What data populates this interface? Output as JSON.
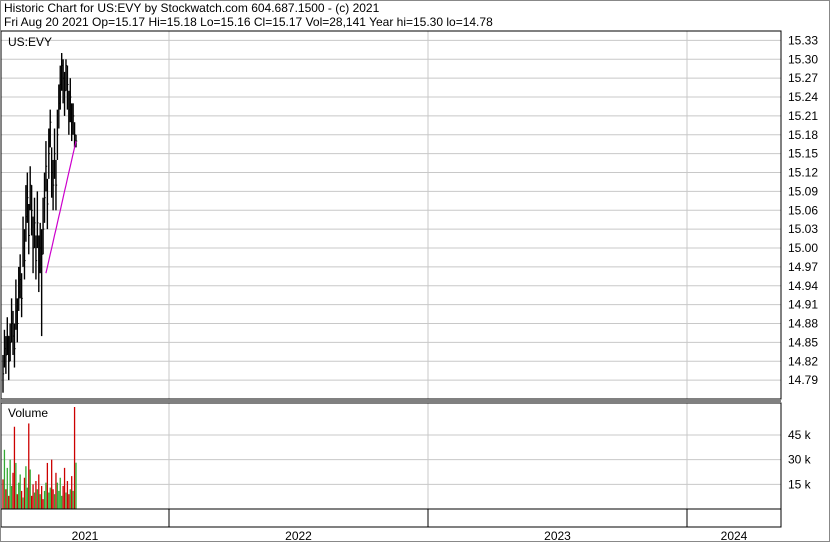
{
  "header": {
    "line1": "Historic Chart for US:EVY by Stockwatch.com 604.687.1500 - (c) 2021",
    "line2": "Fri Aug 20 2021  Op=15.17  Hi=15.18  Lo=15.16  Cl=15.17  Vol=28,141  Year hi=15.30  lo=14.78"
  },
  "colors": {
    "price": "#000000",
    "moving_average": "#cc00cc",
    "volume_up": "#33aa33",
    "volume_down": "#cc0000",
    "grid": "#c8c8c8",
    "frame": "#000000"
  },
  "chart_data": [
    {
      "type": "line",
      "series_label": "US:EVY",
      "y_ticks": [
        "15.33",
        "15.30",
        "15.27",
        "15.24",
        "15.21",
        "15.18",
        "15.15",
        "15.12",
        "15.09",
        "15.06",
        "15.03",
        "15.00",
        "14.97",
        "14.94",
        "14.91",
        "14.88",
        "14.85",
        "14.82",
        "14.79"
      ],
      "ylim": [
        14.76,
        15.345
      ],
      "x_ticks": [
        "2021",
        "2022",
        "2023",
        "2024"
      ],
      "year_hi": 15.3,
      "year_lo": 14.78,
      "grid": true,
      "series": [
        {
          "values": [
            14.8,
            14.84,
            14.83,
            14.86,
            14.82,
            14.85,
            14.88,
            14.86,
            14.84,
            14.9,
            14.88,
            14.93,
            14.95,
            14.92,
            15.0,
            14.98,
            15.05,
            15.08,
            15.02,
            15.1,
            15.06,
            15.0,
            15.04,
            14.98,
            15.04,
            14.97,
            15.0,
            14.99,
            15.03,
            15.08,
            15.13,
            15.07,
            15.15,
            15.2,
            15.12,
            15.1,
            15.15,
            15.1,
            15.18,
            15.23,
            15.26,
            15.29,
            15.27,
            15.25,
            15.29,
            15.26,
            15.22,
            15.24,
            15.2,
            15.21,
            15.18,
            15.17
          ],
          "highs": [
            14.83,
            14.87,
            14.86,
            14.89,
            14.86,
            14.88,
            14.92,
            14.9,
            14.88,
            14.95,
            14.92,
            14.97,
            14.99,
            14.96,
            15.05,
            15.03,
            15.1,
            15.12,
            15.07,
            15.13,
            15.1,
            15.05,
            15.08,
            15.02,
            15.09,
            15.02,
            15.04,
            15.03,
            15.08,
            15.12,
            15.17,
            15.11,
            15.19,
            15.22,
            15.16,
            15.14,
            15.19,
            15.14,
            15.22,
            15.26,
            15.29,
            15.31,
            15.3,
            15.28,
            15.3,
            15.29,
            15.25,
            15.27,
            15.23,
            15.23,
            15.2,
            15.18
          ],
          "lows": [
            14.77,
            14.81,
            14.8,
            14.83,
            14.79,
            14.82,
            14.85,
            14.83,
            14.81,
            14.87,
            14.85,
            14.9,
            14.92,
            14.89,
            14.97,
            14.95,
            15.01,
            15.04,
            14.99,
            15.06,
            15.02,
            14.96,
            15.0,
            14.95,
            15.0,
            14.93,
            14.96,
            14.86,
            14.99,
            15.04,
            15.09,
            15.03,
            15.11,
            15.16,
            15.08,
            15.06,
            15.11,
            15.06,
            15.14,
            15.19,
            15.22,
            15.25,
            15.23,
            15.21,
            15.25,
            15.22,
            15.18,
            15.2,
            15.17,
            15.18,
            15.16,
            15.16
          ]
        },
        {
          "type": "moving_average",
          "start_index": 30,
          "values": [
            14.96,
            14.97,
            14.98,
            14.99,
            15.0,
            15.01,
            15.02,
            15.03,
            15.04,
            15.05,
            15.06,
            15.07,
            15.08,
            15.09,
            15.1,
            15.11,
            15.12,
            15.13,
            15.14,
            15.15,
            15.16,
            15.17
          ]
        }
      ]
    },
    {
      "type": "bar",
      "series_label": "Volume",
      "y_ticks": [
        "45 k",
        "30 k",
        "15 k"
      ],
      "ylim": [
        0,
        62000
      ],
      "values": [
        18000,
        36000,
        12000,
        25000,
        8000,
        30000,
        14000,
        22000,
        50000,
        28000,
        9000,
        16000,
        21000,
        11000,
        7000,
        19000,
        26000,
        13000,
        52000,
        24000,
        8000,
        15000,
        10000,
        17000,
        12000,
        21000,
        9000,
        14000,
        6000,
        11000,
        16000,
        28000,
        10000,
        13000,
        30000,
        12000,
        9000,
        22000,
        16000,
        11000,
        19000,
        8000,
        14000,
        25000,
        10000,
        17000,
        9000,
        12000,
        20000,
        11000,
        62000,
        28141
      ],
      "up": [
        false,
        true,
        false,
        true,
        false,
        true,
        true,
        false,
        false,
        true,
        false,
        true,
        true,
        false,
        true,
        false,
        true,
        true,
        false,
        true,
        false,
        false,
        true,
        false,
        true,
        false,
        true,
        false,
        false,
        true,
        true,
        false,
        true,
        true,
        false,
        false,
        true,
        false,
        true,
        true,
        true,
        true,
        false,
        false,
        true,
        false,
        false,
        true,
        false,
        true,
        false,
        true
      ]
    }
  ]
}
